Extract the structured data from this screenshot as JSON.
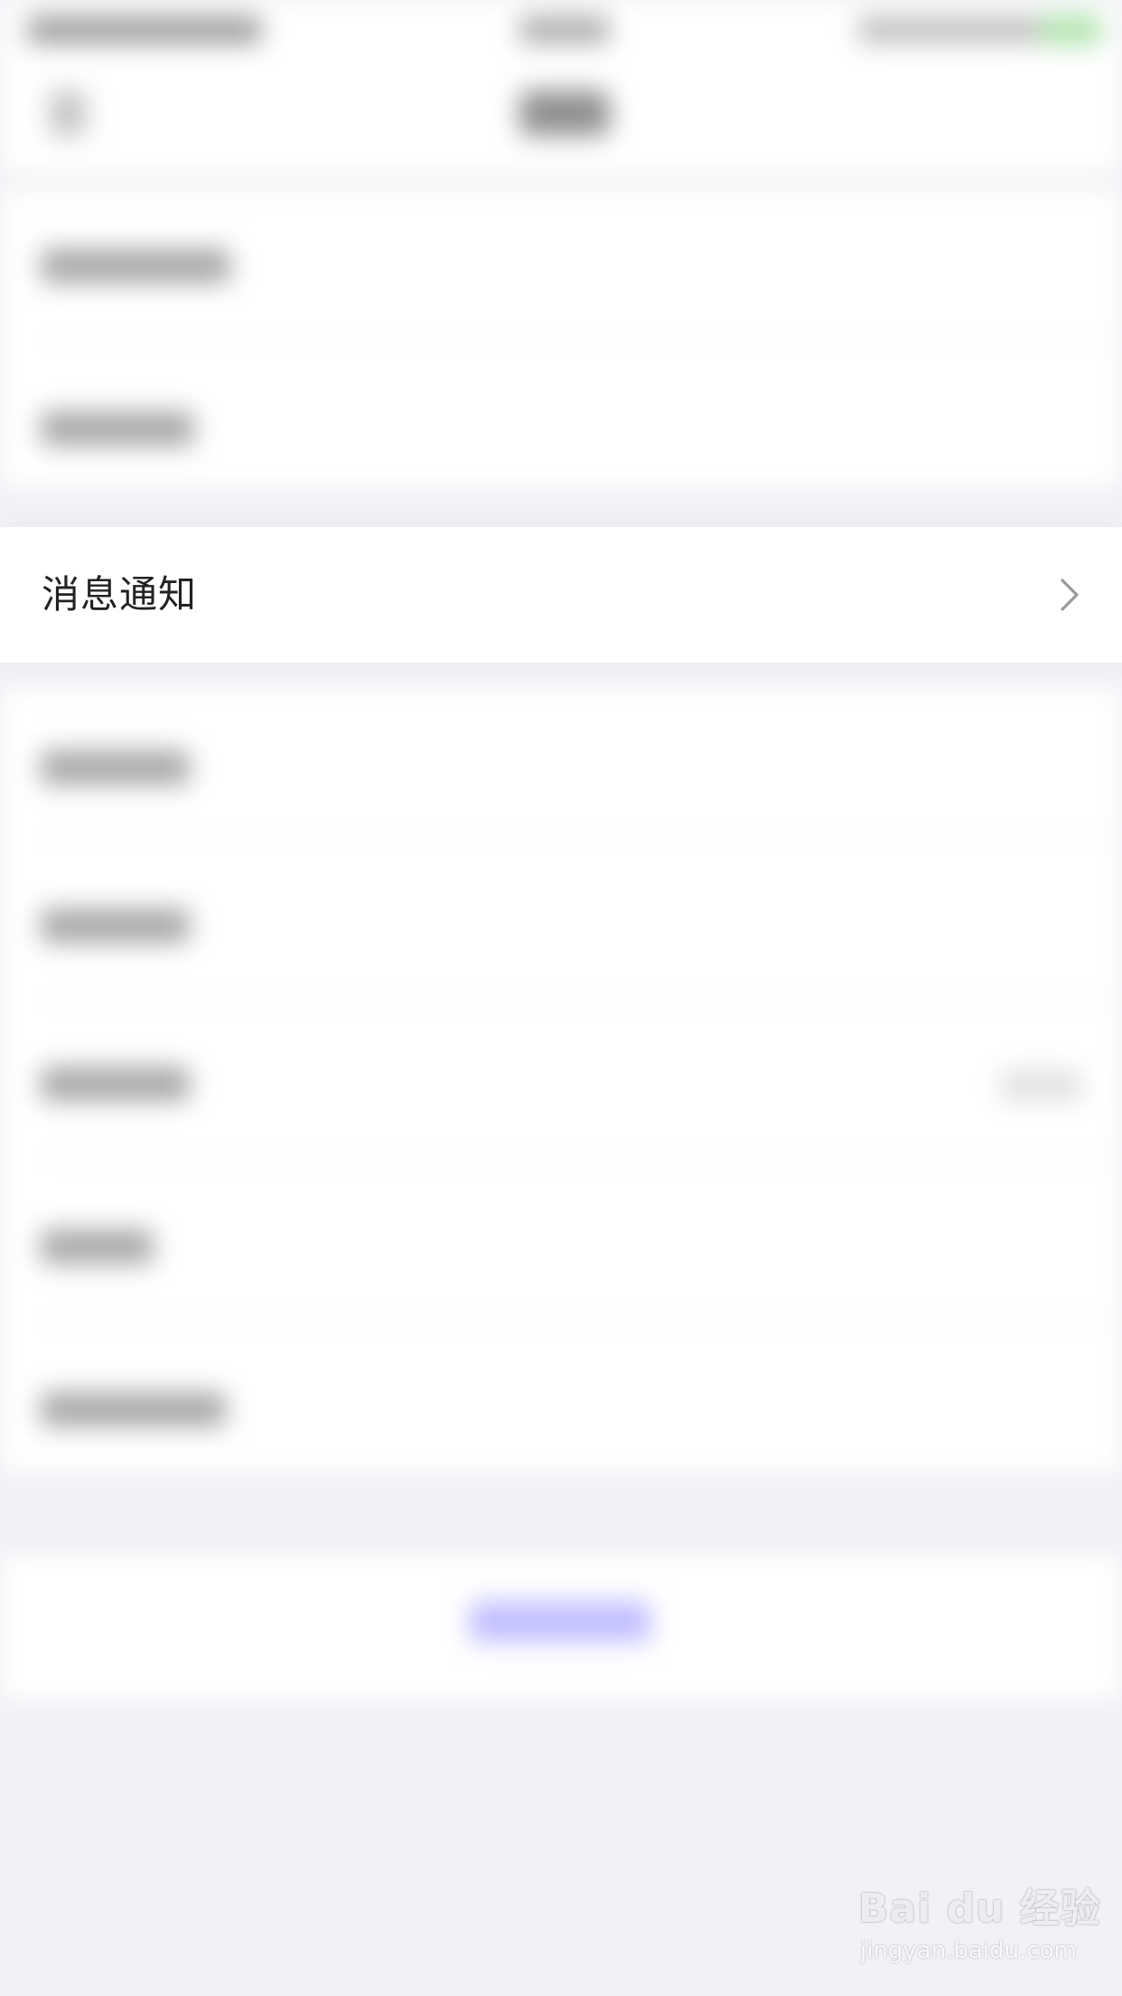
{
  "settings": {
    "notification_row": {
      "label": "消息通知",
      "chevron_icon": "chevron-right-icon"
    }
  },
  "watermark": {
    "brand": "Bai du 经验",
    "url": "jingyan.baidu.com"
  },
  "colors": {
    "background": "#f1f1f6",
    "row_background": "#ffffff",
    "label_text": "#222222",
    "chevron": "#9a9a9a",
    "blurred_button": "#8b85ff",
    "blurred_battery": "#7ed07a"
  }
}
